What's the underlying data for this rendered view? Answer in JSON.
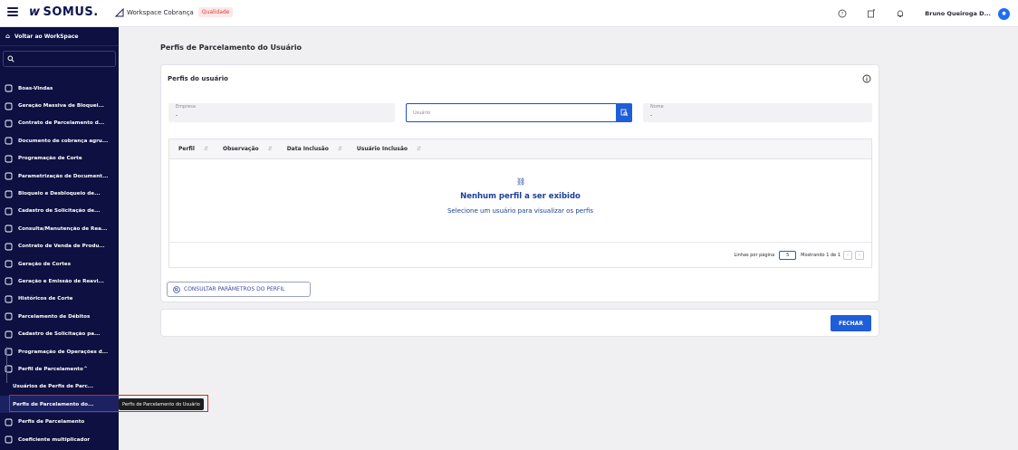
{
  "topbar": {
    "logo": "SOMUS.",
    "workspace_label": "Workspace Cobrança",
    "env_badge": "Qualidade",
    "username": "Bruno Queiroga D...",
    "icons": [
      "help-icon",
      "announcement-icon",
      "bell-icon"
    ]
  },
  "sidebar": {
    "back_label": "Voltar ao WorkSpace",
    "items": [
      {
        "label": "Boas-Vindas",
        "icon": "people-icon"
      },
      {
        "label": "Geração Massiva de Bloquei...",
        "icon": "cycle-icon"
      },
      {
        "label": "Contrato de Parcelamento d...",
        "icon": "contract-icon"
      },
      {
        "label": "Documento de cobrança agru...",
        "icon": "document-icon"
      },
      {
        "label": "Programação de Corte",
        "icon": "cut-icon"
      },
      {
        "label": "Parametrização de Document...",
        "icon": "settings-icon"
      },
      {
        "label": "Bloqueio e Desbloqueio de...",
        "icon": "block-icon"
      },
      {
        "label": "Cadastro de Solicitação de...",
        "icon": "request-icon"
      },
      {
        "label": "Consulta/Manutenção de Rea...",
        "icon": "consult-icon"
      },
      {
        "label": "Contrato de Venda de Produ...",
        "icon": "sale-icon"
      },
      {
        "label": "Geração de Cortes",
        "icon": "cuts-icon"
      },
      {
        "label": "Geração e Emissão de Reavi...",
        "icon": "emit-icon"
      },
      {
        "label": "Históricos de Corte",
        "icon": "history-icon"
      },
      {
        "label": "Parcelamento de Débitos",
        "icon": "dollar-icon"
      },
      {
        "label": "Cadastro de Solicitação pa...",
        "icon": "form-icon"
      },
      {
        "label": "Programação de Operações d...",
        "icon": "calendar-icon"
      },
      {
        "label": "Perfil de Parcelamento",
        "icon": "profile-icon",
        "expanded": true
      },
      {
        "label": "Usuários de Perfis de Parc...",
        "sub": true
      },
      {
        "label": "Perfis de Parcelamento do...",
        "sub": true,
        "active": true
      },
      {
        "label": "Perfis de Parcelamento",
        "icon": "list-icon"
      },
      {
        "label": "Coeficiente multiplicador",
        "icon": "list-icon"
      }
    ],
    "tooltip": "Perfis de Parcelamento do Usuário"
  },
  "main": {
    "title": "Perfis de Parcelamento do Usuário",
    "card_title": "Perfis do usuário",
    "empresa": {
      "label": "Empresa",
      "value": "-"
    },
    "usuario": {
      "placeholder": "Usuário"
    },
    "nome": {
      "label": "Nome",
      "value": "-"
    },
    "columns": [
      "Perfil",
      "Observação",
      "Data Inclusão",
      "Usuário Inclusão"
    ],
    "empty_title": "Nenhum perfil a ser exibido",
    "empty_subtitle": "Selecione um usuário para visualizar os perfis",
    "pager": {
      "rows_label": "Linhas por página",
      "rows_value": "5",
      "showing": "Mostrando 1 de 1"
    },
    "consult_button": "CONSULTAR PARÂMETROS DO PERFIL",
    "close_button": "FECHAR"
  }
}
